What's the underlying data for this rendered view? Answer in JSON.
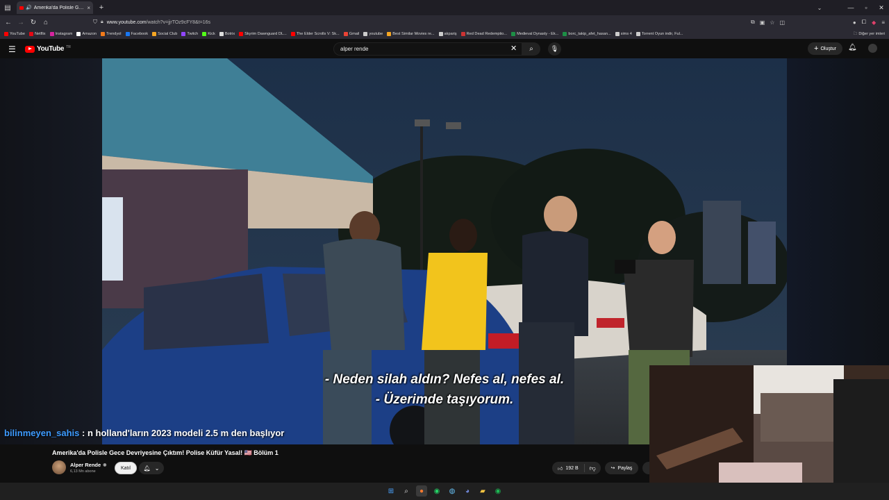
{
  "browser": {
    "tab_title": "Amerika'da Polisle Gece Devriyesine Çıktım! Polise Küfür Yasal!",
    "tab_close": "×",
    "new_tab": "+",
    "url_host": "www.youtube.com",
    "url_path": "/watch?v=jjrTOz9cFY8&t=16s",
    "window_controls": [
      "—",
      "▫",
      "✕"
    ]
  },
  "bookmarks": [
    {
      "label": "YouTube",
      "color": "#ff0000"
    },
    {
      "label": "Netflix",
      "color": "#e50914"
    },
    {
      "label": "Instagram",
      "color": "#d6249f"
    },
    {
      "label": "Amazon",
      "color": "#ffffff"
    },
    {
      "label": "Trendyol",
      "color": "#f27a1a"
    },
    {
      "label": "Facebook",
      "color": "#1877f2"
    },
    {
      "label": "Social Club",
      "color": "#f5a623"
    },
    {
      "label": "Twitch",
      "color": "#9146ff"
    },
    {
      "label": "Kick",
      "color": "#53fc18"
    },
    {
      "label": "Botrix",
      "color": "#dddddd"
    },
    {
      "label": "Skyrim Dawnguard DL...",
      "color": "#ff0000"
    },
    {
      "label": "The Elder Scrolls V: Sk...",
      "color": "#ff0000"
    },
    {
      "label": "Gmail",
      "color": "#ea4335"
    },
    {
      "label": "youtube",
      "color": "#cccccc"
    },
    {
      "label": "Best Similar Movies re...",
      "color": "#f5a623"
    },
    {
      "label": "akpariş",
      "color": "#cccccc"
    },
    {
      "label": "Red Dead Redemptio...",
      "color": "#cc3333"
    },
    {
      "label": "Medieval Dynasty - Ek...",
      "color": "#1d8f46"
    },
    {
      "label": "borc_takip_afet_hasan...",
      "color": "#1d8f46"
    },
    {
      "label": "sims 4",
      "color": "#cccccc"
    },
    {
      "label": "Torrent Oyun indir, Ful...",
      "color": "#cccccc"
    }
  ],
  "other_bookmarks": "Diğer yer imleri",
  "youtube": {
    "logo": "YouTube",
    "logo_region": "TR",
    "search_value": "alper rende",
    "create_label": "Oluştur"
  },
  "video": {
    "subtitle_line1": "- Neden silah aldın? Nefes al, nefes al.",
    "subtitle_line2": "- Üzerimde taşıyorum.",
    "chat_user": "bilinmeyen_sahis",
    "chat_message": ": n holland'ların 2023 modeli 2.5 m den başlıyor",
    "title": "Amerika'da Polisle Gece Devriyesine Çıktım! Polise Küfür Yasal! 🇺🇸 Bölüm 1"
  },
  "channel": {
    "name": "Alper Rende",
    "subscribers": "6,13 Mn abone",
    "join_label": "Katıl"
  },
  "actions": {
    "likes": "192 B",
    "share_label": "Paylaş"
  },
  "colors": {
    "yt_red": "#ff0000",
    "chat_user": "#3d9bff",
    "bg": "#0f0f0f"
  }
}
